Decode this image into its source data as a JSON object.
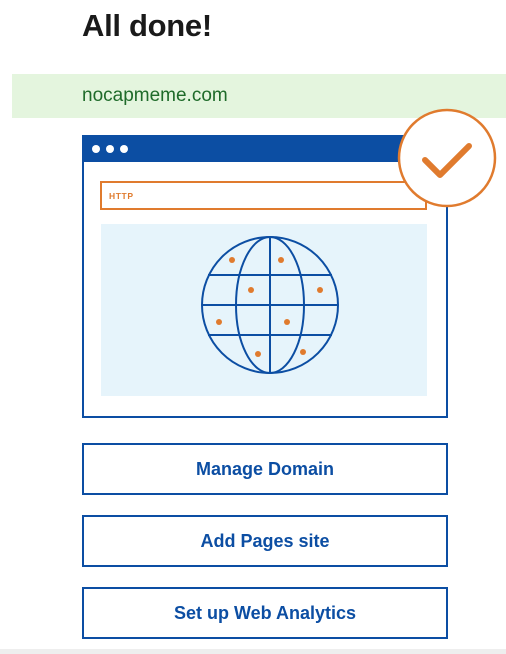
{
  "header": {
    "title": "All done!"
  },
  "domain": {
    "name": "nocapmeme.com"
  },
  "illustration": {
    "address_bar_text": "HTTP",
    "browser_icon": "browser-window-icon",
    "globe_icon": "globe-icon",
    "status_icon": "checkmark-circle-icon",
    "colors": {
      "primary_blue": "#0c4ea3",
      "accent_orange": "#e07b2e",
      "viewport_bg": "#e6f4fb",
      "success_green_bg": "#e4f5de",
      "success_green_text": "#1f6b2a"
    }
  },
  "actions": {
    "manage_domain": "Manage Domain",
    "add_pages_site": "Add Pages site",
    "setup_web_analytics": "Set up Web Analytics"
  }
}
